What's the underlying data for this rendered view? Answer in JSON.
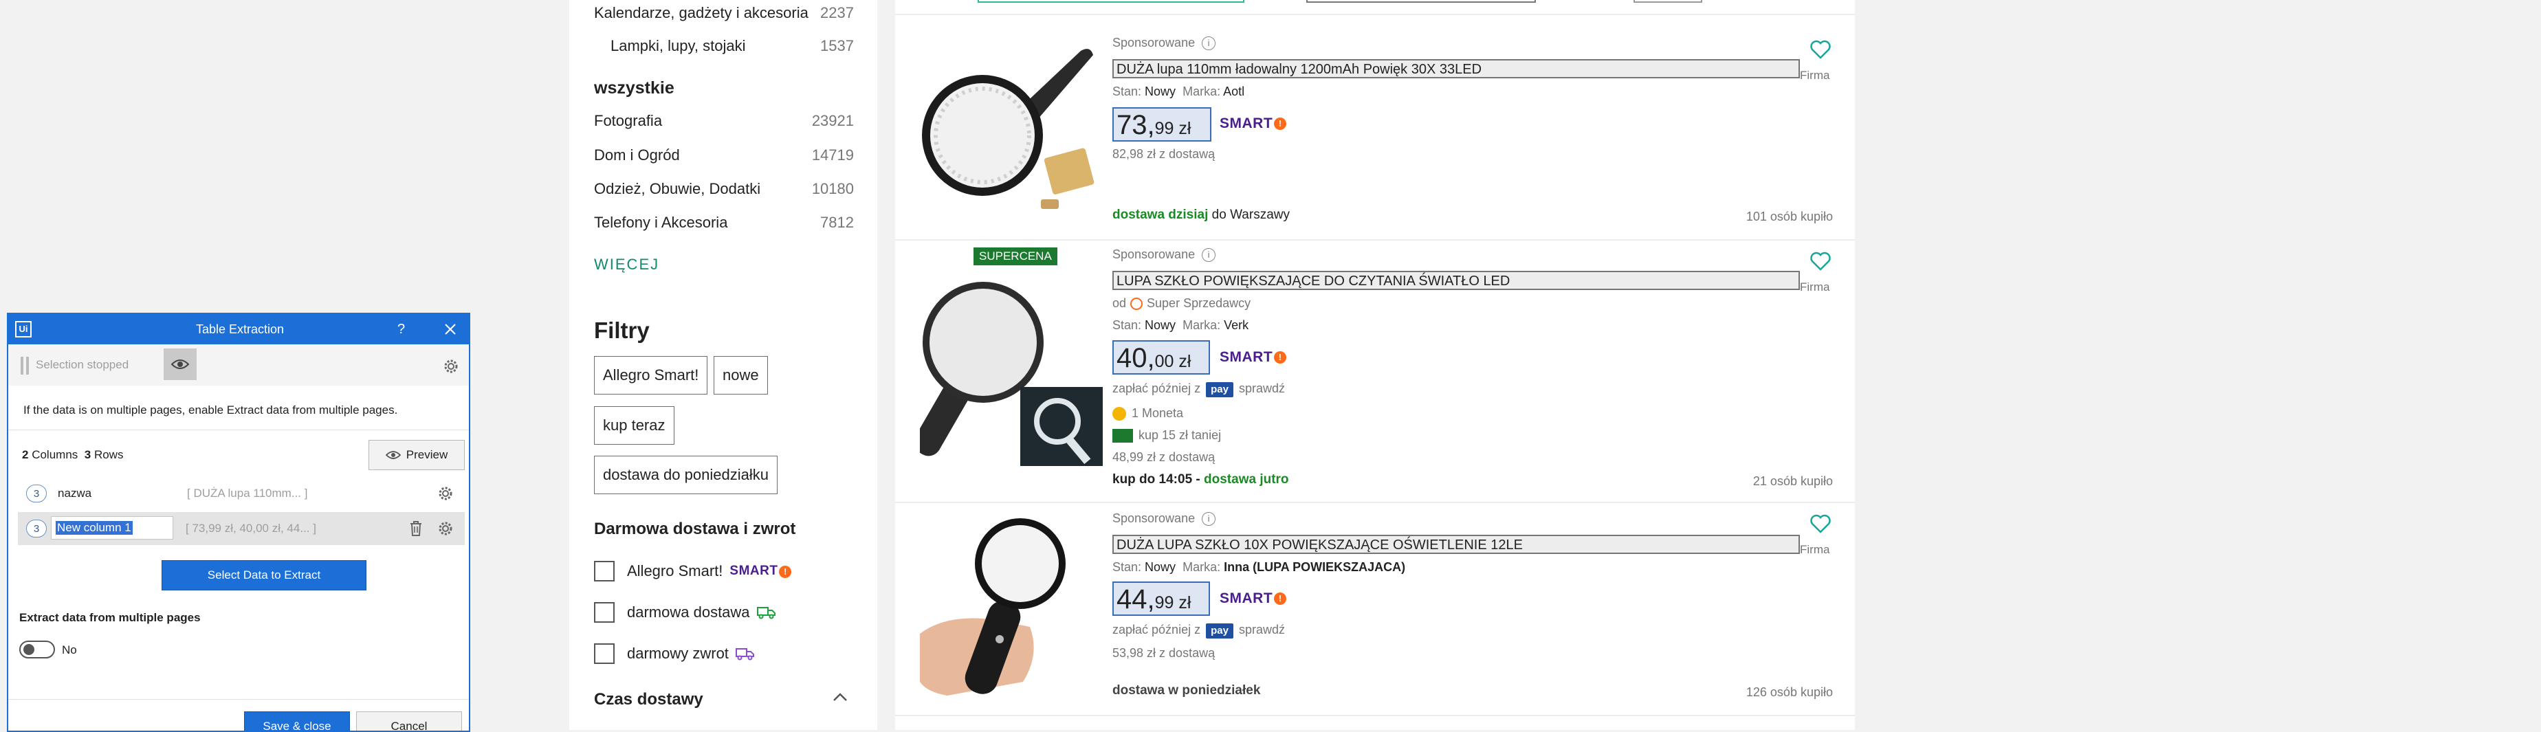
{
  "sidebar": {
    "categories": [
      {
        "label": "Kalendarze, gadżety i akcesoria",
        "count": "2237"
      },
      {
        "label": "Lampki, lupy, stojaki",
        "count": "1537"
      }
    ],
    "all_heading": "wszystkie",
    "all_categories": [
      {
        "label": "Fotografia",
        "count": "23921"
      },
      {
        "label": "Dom i Ogród",
        "count": "14719"
      },
      {
        "label": "Odzież, Obuwie, Dodatki",
        "count": "10180"
      },
      {
        "label": "Telefony i Akcesoria",
        "count": "7812"
      }
    ],
    "more_link": "WIĘCEJ",
    "filters_title": "Filtry",
    "filter_chips": [
      "Allegro Smart!",
      "nowe",
      "kup teraz",
      "dostawa do poniedziałku"
    ],
    "free_delivery_title": "Darmowa dostawa i zwrot",
    "checkboxes": [
      {
        "label": "Allegro Smart!",
        "badge": "SMART"
      },
      {
        "label": "darmowa dostawa",
        "icon": "truck-icon"
      },
      {
        "label": "darmowy zwrot",
        "icon": "return-truck-icon"
      }
    ],
    "delivery_time_title": "Czas dostawy"
  },
  "listing": {
    "products": [
      {
        "sponsored": "Sponsorowane",
        "title": "DUŻA lupa 110mm ładowalny 1200mAh Powięk 30X 33LED",
        "state_label": "Stan:",
        "state": "Nowy",
        "brand_label": "Marka:",
        "brand": "Aotl",
        "price_main": "73,",
        "price_fraction": "99 zł",
        "smart": "SMART",
        "delivery_price": "82,98 zł z dostawą",
        "delivery_green": "dostawa dzisiaj",
        "delivery_rest": "do Warszawy",
        "bought": "101 osób kupiło",
        "firm": "Firma"
      },
      {
        "supercena": "SUPERCENA",
        "sponsored": "Sponsorowane",
        "title": "LUPA SZKŁO POWIĘKSZAJĄCE DO CZYTANIA ŚWIATŁO LED",
        "seller_prefix": "od",
        "seller": "Super Sprzedawcy",
        "state_label": "Stan:",
        "state": "Nowy",
        "brand_label": "Marka:",
        "brand": "Verk",
        "price_main": "40,",
        "price_fraction": "00 zł",
        "smart": "SMART",
        "paylater_prefix": "zapłać później z",
        "pay": "pay",
        "paylater_check": "sprawdź",
        "coins": "1 Moneta",
        "cheaper": "kup 15 zł taniej",
        "delivery_price": "48,99 zł z dostawą",
        "delivery_prefix": "kup do 14:05 -",
        "delivery_green": "dostawa jutro",
        "bought": "21 osób kupiło",
        "firm": "Firma"
      },
      {
        "sponsored": "Sponsorowane",
        "title": "DUŻA LUPA SZKŁO 10X POWIĘKSZAJĄCE OŚWIETLENIE 12LE",
        "state_label": "Stan:",
        "state": "Nowy",
        "brand_label": "Marka:",
        "brand": "Inna (LUPA POWIEKSZAJACA)",
        "price_main": "44,",
        "price_fraction": "99 zł",
        "smart": "SMART",
        "paylater_prefix": "zapłać później z",
        "pay": "pay",
        "paylater_check": "sprawdź",
        "delivery_price": "53,98 zł z dostawą",
        "delivery_text": "dostawa w poniedziałek",
        "bought": "126 osób kupiło",
        "firm": "Firma"
      }
    ]
  },
  "dialog": {
    "title": "Table Extraction",
    "help": "?",
    "selection_status": "Selection stopped",
    "hint": "If the data is on multiple pages, enable Extract data from multiple pages.",
    "columns_count": "2",
    "columns_label": "Columns",
    "rows_count": "3",
    "rows_label": "Rows",
    "preview": "Preview",
    "columns": [
      {
        "badge": "3",
        "name": "nazwa",
        "sample": "[ DUŻA lupa 110mm...  ]"
      },
      {
        "badge": "3",
        "name": "New column 1",
        "sample": "[ 73,99 zł, 40,00 zł, 44... ]"
      }
    ],
    "select_button": "Select Data to Extract",
    "multi_page_title": "Extract data from multiple pages",
    "toggle_label": "No",
    "save_button": "Save & close",
    "cancel_button": "Cancel"
  }
}
